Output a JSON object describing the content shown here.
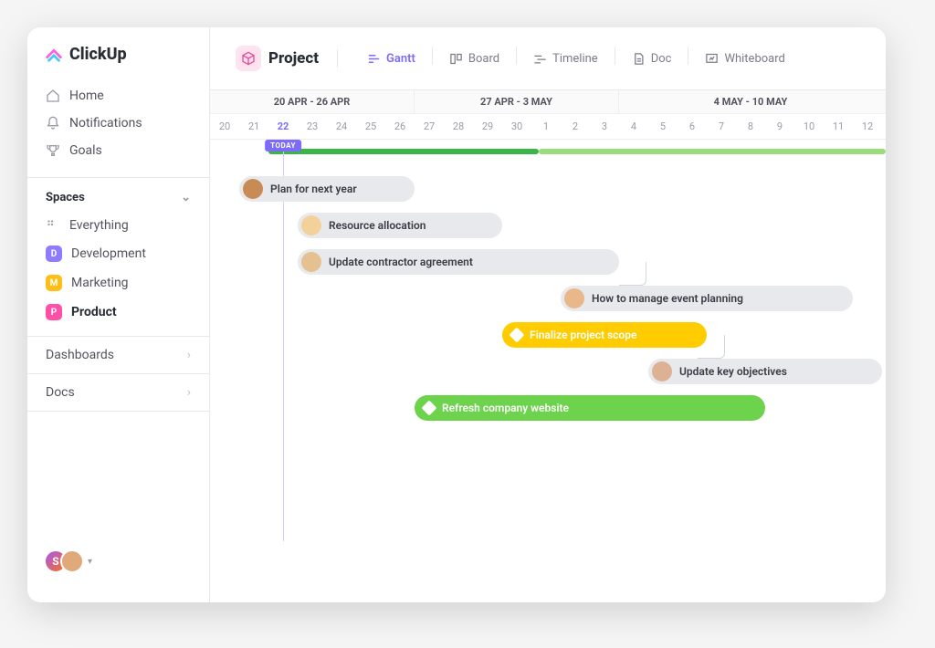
{
  "brand": {
    "name": "ClickUp"
  },
  "nav": {
    "home": "Home",
    "notifications": "Notifications",
    "goals": "Goals"
  },
  "spaces": {
    "header": "Spaces",
    "everything": "Everything",
    "items": [
      {
        "letter": "D",
        "label": "Development",
        "color": "#8d7cff"
      },
      {
        "letter": "M",
        "label": "Marketing",
        "color": "#ffbe16"
      },
      {
        "letter": "P",
        "label": "Product",
        "color": "#ff4fa7",
        "active": true
      }
    ]
  },
  "flat_nav": {
    "dashboards": "Dashboards",
    "docs": "Docs"
  },
  "presence": {
    "user1_initial": "S"
  },
  "project": {
    "title": "Project"
  },
  "views": {
    "gantt": "Gantt",
    "board": "Board",
    "timeline": "Timeline",
    "doc": "Doc",
    "whiteboard": "Whiteboard"
  },
  "timeline": {
    "weeks": [
      "20 APR - 26 APR",
      "27 APR - 3 MAY",
      "4 MAY - 10 MAY"
    ],
    "days": [
      "20",
      "21",
      "22",
      "23",
      "24",
      "25",
      "26",
      "27",
      "28",
      "29",
      "30",
      "1",
      "2",
      "3",
      "4",
      "5",
      "6",
      "7",
      "8",
      "9",
      "10",
      "11",
      "12"
    ],
    "today_index": 2,
    "today_label": "TODAY"
  },
  "tasks": [
    {
      "label": "Plan for next year",
      "type": "gray",
      "start": 1,
      "span": 6,
      "row": 0,
      "avatar": "#c98b55"
    },
    {
      "label": "Resource allocation",
      "type": "gray",
      "start": 3,
      "span": 7,
      "row": 1,
      "avatar": "#f2d19a"
    },
    {
      "label": "Update contractor agreement",
      "type": "gray",
      "start": 3,
      "span": 11,
      "row": 2,
      "avatar": "#e5c090"
    },
    {
      "label": "How to manage event planning",
      "type": "gray",
      "start": 12,
      "span": 10,
      "row": 3,
      "avatar": "#e8b78a"
    },
    {
      "label": "Finalize project scope",
      "type": "yellow",
      "start": 10,
      "span": 7,
      "row": 4,
      "diamond": true
    },
    {
      "label": "Update key objectives",
      "type": "gray",
      "start": 15,
      "span": 8,
      "row": 5,
      "avatar": "#ddb294"
    },
    {
      "label": "Refresh company website",
      "type": "green",
      "start": 7,
      "span": 12,
      "row": 6,
      "diamond": true
    }
  ],
  "chart_data": {
    "type": "gantt",
    "date_range": {
      "start": "2020-04-20",
      "end": "2020-05-12"
    },
    "today": "2020-04-22",
    "weeks": [
      {
        "label": "20 APR - 26 APR",
        "start": "2020-04-20",
        "end": "2020-04-26"
      },
      {
        "label": "27 APR - 3 MAY",
        "start": "2020-04-27",
        "end": "2020-05-03"
      },
      {
        "label": "4 MAY - 10 MAY",
        "start": "2020-05-04",
        "end": "2020-05-10"
      }
    ],
    "tasks": [
      {
        "name": "Plan for next year",
        "start": "2020-04-21",
        "end": "2020-04-26",
        "status": "open"
      },
      {
        "name": "Resource allocation",
        "start": "2020-04-23",
        "end": "2020-04-29",
        "status": "open"
      },
      {
        "name": "Update contractor agreement",
        "start": "2020-04-23",
        "end": "2020-05-03",
        "status": "open"
      },
      {
        "name": "How to manage event planning",
        "start": "2020-05-02",
        "end": "2020-05-11",
        "status": "open"
      },
      {
        "name": "Finalize project scope",
        "start": "2020-04-30",
        "end": "2020-05-06",
        "status": "in-progress",
        "milestone": true
      },
      {
        "name": "Update key objectives",
        "start": "2020-05-05",
        "end": "2020-05-12",
        "status": "open"
      },
      {
        "name": "Refresh company website",
        "start": "2020-04-27",
        "end": "2020-05-08",
        "status": "complete",
        "milestone": true
      }
    ],
    "progress_bar": {
      "complete_until": "2020-04-30",
      "extends_to": "2020-05-12"
    }
  }
}
